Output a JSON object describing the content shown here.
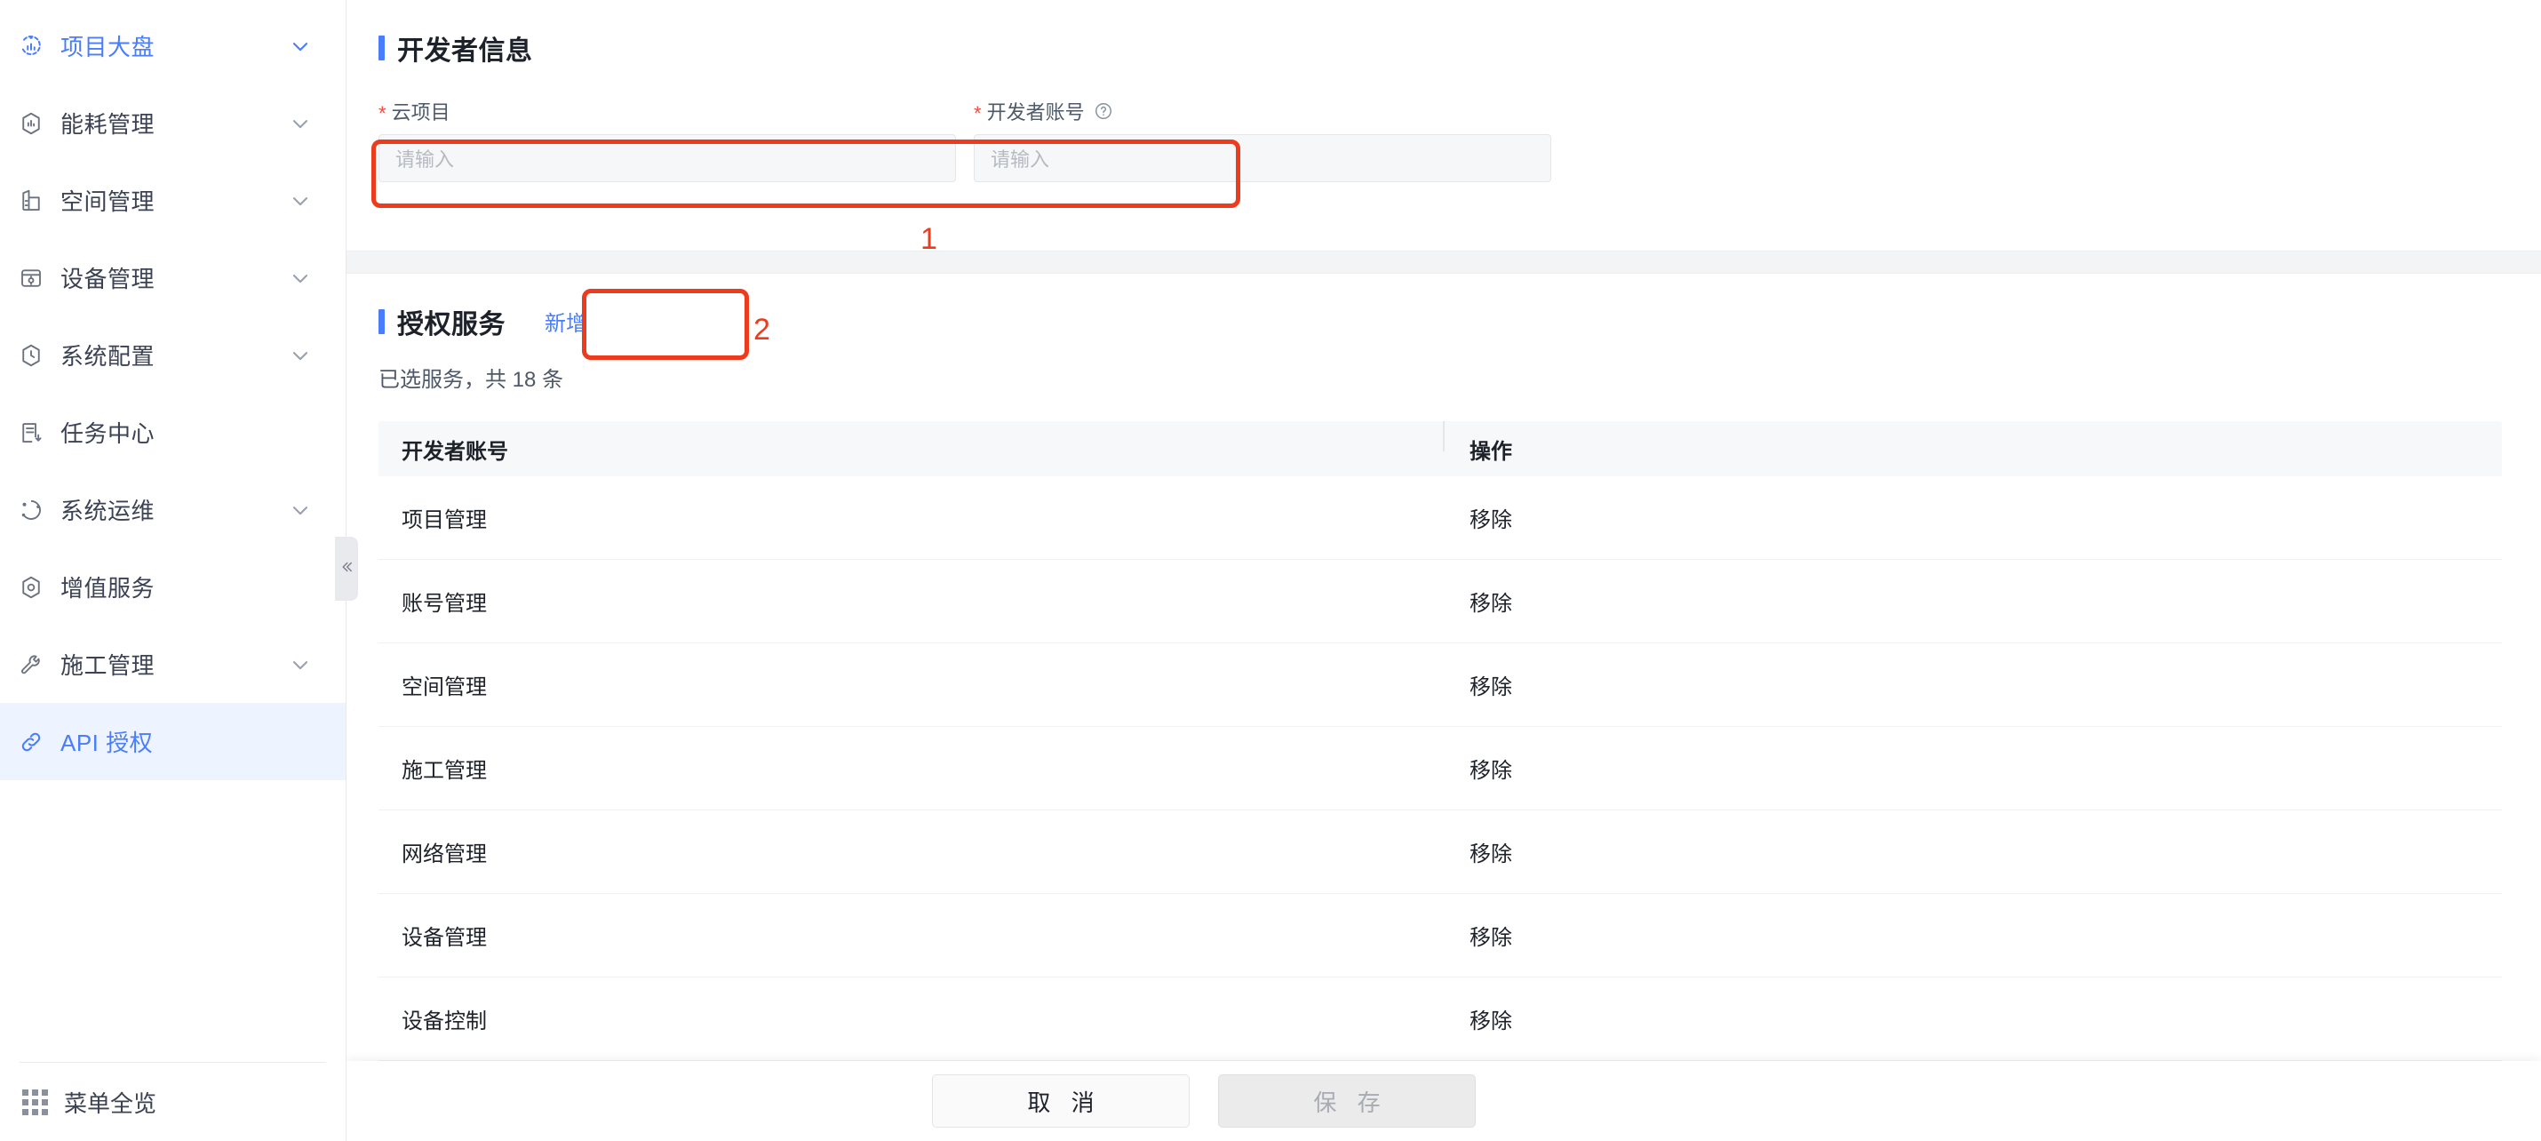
{
  "sidebar": {
    "items": [
      {
        "label": "项目大盘",
        "icon": "dashboard-icon",
        "expandable": true,
        "state": "accent"
      },
      {
        "label": "能耗管理",
        "icon": "energy-icon",
        "expandable": true,
        "state": "normal"
      },
      {
        "label": "空间管理",
        "icon": "building-icon",
        "expandable": true,
        "state": "normal"
      },
      {
        "label": "设备管理",
        "icon": "device-icon",
        "expandable": true,
        "state": "normal"
      },
      {
        "label": "系统配置",
        "icon": "config-icon",
        "expandable": true,
        "state": "normal"
      },
      {
        "label": "任务中心",
        "icon": "task-icon",
        "expandable": false,
        "state": "normal"
      },
      {
        "label": "系统运维",
        "icon": "ops-icon",
        "expandable": true,
        "state": "normal"
      },
      {
        "label": "增值服务",
        "icon": "value-service-icon",
        "expandable": false,
        "state": "normal"
      },
      {
        "label": "施工管理",
        "icon": "wrench-icon",
        "expandable": true,
        "state": "normal"
      },
      {
        "label": "API 授权",
        "icon": "link-icon",
        "expandable": false,
        "state": "active"
      }
    ],
    "bottom": {
      "label": "菜单全览",
      "icon": "grid-icon"
    },
    "collapse": {
      "icon": "double-chevron-left-icon"
    }
  },
  "developer_info": {
    "title": "开发者信息",
    "fields": [
      {
        "label": "云项目",
        "required": true,
        "value": "",
        "placeholder": "请输入",
        "help": false
      },
      {
        "label": "开发者账号",
        "required": true,
        "value": "",
        "placeholder": "请输入",
        "help": true
      }
    ]
  },
  "auth_services": {
    "title": "授权服务",
    "add_label": "新增",
    "count_text": "已选服务，共 18 条",
    "table": {
      "columns": [
        "开发者账号",
        "操作"
      ],
      "action_label": "移除",
      "rows": [
        {
          "name": "项目管理"
        },
        {
          "name": "账号管理"
        },
        {
          "name": "空间管理"
        },
        {
          "name": "施工管理"
        },
        {
          "name": "网络管理"
        },
        {
          "name": "设备管理"
        },
        {
          "name": "设备控制"
        }
      ]
    }
  },
  "footer": {
    "cancel_label": "取 消",
    "save_label": "保 存",
    "save_disabled": true
  },
  "annotations": [
    {
      "id": "1",
      "number": "1",
      "target": "云项目 input"
    },
    {
      "id": "2",
      "number": "2",
      "target": "新增 button"
    }
  ],
  "colors": {
    "accent": "#4a7dfc",
    "annotation": "#ed3b1e",
    "required": "#f5483b",
    "text": "#1d2129",
    "muted": "#4e5969",
    "active_bg": "#eef4ff"
  }
}
